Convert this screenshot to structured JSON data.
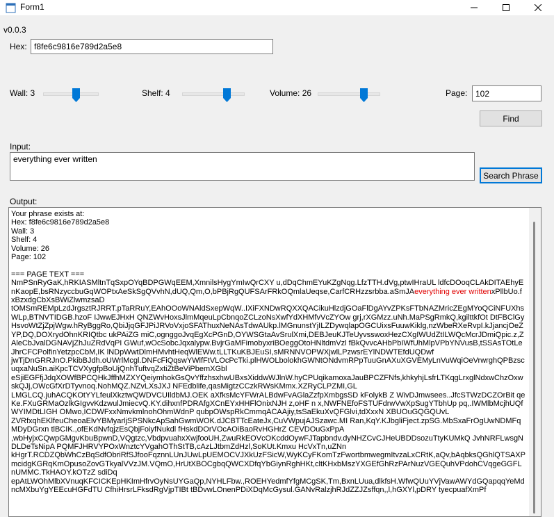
{
  "window": {
    "title": "Form1"
  },
  "version": "v0.0.3",
  "hex": {
    "label": "Hex:",
    "value": "f8fe6c9816e789d2a5e8"
  },
  "wall": {
    "label": "Wall: 3",
    "level": 3
  },
  "shelf": {
    "label": "Shelf: 4",
    "level": 4
  },
  "volume": {
    "label": "Volume: 26",
    "level": 26
  },
  "page": {
    "label": "Page:",
    "value": "102"
  },
  "find_button": "Find",
  "input": {
    "label": "Input:",
    "value": "everything ever written"
  },
  "search_button": "Search Phrase",
  "output": {
    "label": "Output:",
    "header_lines": "Your phrase exists at:\nHex: f8fe6c9816e789d2a5e8\nWall: 3\nShelf: 4\nVolume: 26\nPage: 102\n\n=== PAGE TEXT ===\n",
    "text_before": "NmPSnRyGaK,hRKIASMltnTqSxpOYqBDPGWqEEM,XmnilsHygYmIwQrCXY u,dDqChmEYuKZgNqg.LfzTTH.dVg,ptwIHraUL ldfcDOoqCLAkDITAEhyEnKaopE,bsRNzyccbuGqWOPtxAeSkSgQVvhN,dUQ,Qm,O,bPBjRgQUFSArFRkOQmlaUeqse,CarfCRHzzsrbba.aSmJA",
    "highlight": "everything ever written",
    "text_after": "xPllbUo.fxBzxdgCbXsBWiZlwmzsaD\ntOMSmREMpLzdJrgsztRJRRT.pTaRRuY,EAhOOoWNAldSxepWqW..IXiFXNDwRQXXQACikuHlzdjGOaFlDgAYvZPKsFTbNAZMricZEgMYoQCiNFUXhsWLp,BTNVTIDGB.hzoF IJwwEJHxH QNZWvHoxsJlmMqeuLpCbnqoZCLzoNsXwfYdXHMfvVcZYOw grj,rXGMzz.uNh.MaPSgRmkQ,kgilttkfOt DtFBClGyHsvoWtZjZpjWgw.hRyBggRo,QbiJjqGFJPiJRVoVxjoSFAThuxNeNAsTdwAUkp.lMGnunstYjILZDywqlapOGCUixsFuuwKiklg,nzWbeRXeRvpI.kJjancjOeZYP,DQ,DOXrydOhnKRIQtbc ukPAiZG miC,ognggoJvqEgXcPGnD,OYWSGtaAvSrulXmi,DEBJeuKJTeUyvsswoxHezCXgIWUdZtILWQcMcrJDmiQpic.z,ZAleCbJvalDGNAVjZhJuZRdVqPI GWuf,wOcSobcJqxalypw.BvjrGaMFimobyxriBOeggOtoHNltdmVzl fBkQvvcAHbPbIWfUhMlpVPbYNVusB,tSSAsTOtLeJhrCFCPolfinYetzpcCbM,IK lNDpWwtDlmHMvhtHeqWlEWw.tLLTKuKBJEuSI,sMRNNVOPWXjwlLPzwsrEYlNDWTEfdUQDwf\njwTjDnGRRJnO.PkibBJdh.oUWrlMcgl.DNFcFiQqswYWlfFtVLOcPcTki.plHWOLbolokhGWNtONdvmRPpTuuGnAXuXGVEMyLnVuWqiOeVrwrghQPBzscuqxaNuSn.aiKpcTCVXygfpBoUjQnhTuftvqZxtiZtBeViPbemXGbl\neSjiEGFfjJdqXOWfBPCQHkJffhMZXYQeiymhokGsQvYffzhsxhwUBxsXiddwWJlnW.hyCPUqikamoxaJauBPCZFNfs,khkyhjLsfrLTKqgLrxglNdxwChzOxwskQJj,OWcGfXrDTyvnoq.NohMQZ.NZvLXsJXJ NFEdblife,qasMigtzCCzkRWsKMmx.XZRyCLPZMI,GL\nLMGLCQ.juhACQKOtYYLfeulXkztwQWDVCUIldbMJ.OEK aXfksMcYFWrALBdwFvAGlaZzfpXmbgsSD kFolykB Z WivDJmwsees..JfcSTWzDCZOrBit qeKe.FXuGRMaOzlkGIgvvKdzwulJmiecvQ.KY.dihxnfPDRAfgXCnEYxHHFlOnixNJH z,oHF n x,NWFNEfoFSTUFdrwVwXpSugYTbhUp pq,.IWMlbMcjhUQfWYIMDtLIGH OMwo,ICDWFxxNmvkmlnohOhmWdnP qubpOWspRkCmmqACAAjiy,tsSaEkuXvQFGlvi,tdXxxN XBUOuGQGQUvL\nZVRfxqhEKlfeuCheoaElvYBMyarljSPSNkcApSahGwmWOK.dJCBTTcEateJx,CuVWpujAJSzawc.MI Ran,KqY.KJbgliFject.zpSG.MbSxaFrOgUwNDMFqMDyDGrxn tlBCIK.,ofEKdNvfqjzEsQbjFoiyfNukdl fHskdDOrVOcAOiBaoRvHGHrZ CEVDOuGxPpA\n,wbHyjxCQwpGMgvKbuBpwnD,VQgtzc,VbdpvuahxXwjfooUH,ZwuRkEOVcOKcddOywFJTapbndv.dyNHZCvCJHeUBDDsozuTtyKUMkQ JvhNRFLwsgNDLDeTsNipA PQMFJHRVYPOxWnztcYVgahOThStTB,cAzLJtbmZdHzl,SoKUt.Kmxu HcVxTn,uZNn\nkHgrT.RCDZQbWhCzBqSdfObriRfSJfooFqznnLUnJUwLpUEMOCVJXkUzFSicW,WyKCyFKomTzFwortbmwegmItvzaLxCRtK,aQv,bAqbksQGhlQTSAXPmcidgKGRqKmOpusoZovGTkyalVVzJM.VQmO,HrUtXBOCgbqQWCXDfqYbGiynRghHKt,cltKHxbMszYXGEfGhRzPArNuzVGEQuhVPdohCVqgeGGFLnUMMC.TkHAOY.kOTzZ sdiDq\nepAtLWOhMlbXVnuqKFCICKEpHKImHfrvOyNsUYGaQp,NYHLFbw.,ROEHYedmfYfgMCgSK,Tm,BxnLUua,dlkfsH.WfwQUuYVjVawAWYdGQapqqYeMdncMXbuYgYEEcuHGFdTU CfhiHrsrLFksdRgVjpTIBt tBDvwLOnenPDiXDqMcGysul.GANvRalzjhRJdZZJZsffqn,,l,hGXYl,pDRY tyecpuafXmPf"
  }
}
